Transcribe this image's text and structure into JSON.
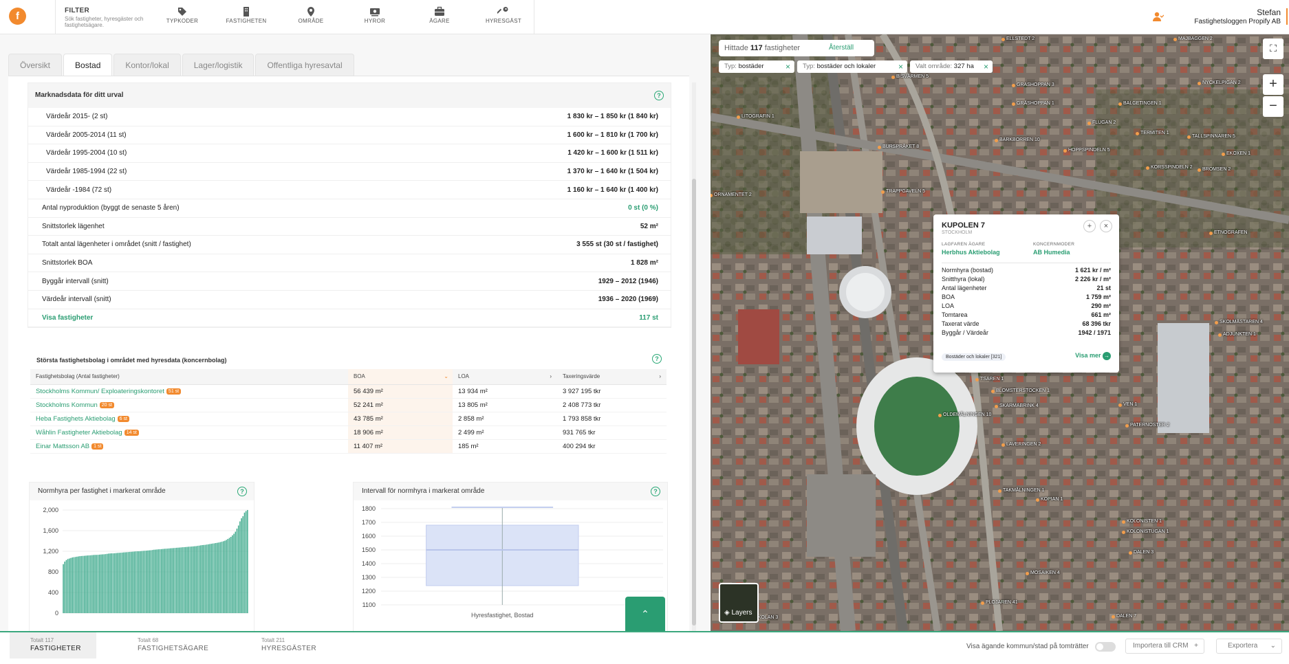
{
  "topbar": {
    "filter_title": "FILTER",
    "filter_desc": "Sök fastigheter, hyresgäster och fastighetsägare.",
    "nav": [
      {
        "label": "TYPKODER",
        "icon": "tag-icon"
      },
      {
        "label": "FASTIGHETEN",
        "icon": "building-icon"
      },
      {
        "label": "OMRÅDE",
        "icon": "map-pin-icon"
      },
      {
        "label": "HYROR",
        "icon": "money-icon"
      },
      {
        "label": "ÄGARE",
        "icon": "briefcase-icon"
      },
      {
        "label": "HYRESGÄST",
        "icon": "key-icon"
      }
    ],
    "user_name": "Stefan",
    "user_org": "Fastighetsloggen Propify AB"
  },
  "tabs": [
    "Översikt",
    "Bostad",
    "Kontor/lokal",
    "Lager/logistik",
    "Offentliga hyresavtal"
  ],
  "active_tab": "Bostad",
  "market": {
    "title": "Marknadsdata för ditt urval",
    "rows": [
      {
        "label": "Värdeår 2015-  (2 st)",
        "value": "1 830 kr – 1 850 kr (1 840 kr)",
        "sub": true
      },
      {
        "label": "Värdeår 2005-2014  (11 st)",
        "value": "1 600 kr – 1 810 kr (1 700 kr)",
        "sub": true
      },
      {
        "label": "Värdeår 1995-2004  (10 st)",
        "value": "1 420 kr – 1 600 kr (1 511 kr)",
        "sub": true
      },
      {
        "label": "Värdeår 1985-1994  (22 st)",
        "value": "1 370 kr – 1 640 kr (1 504 kr)",
        "sub": true
      },
      {
        "label": "Värdeår -1984  (72 st)",
        "value": "1 160 kr – 1 640 kr (1 400 kr)",
        "sub": true
      },
      {
        "label": "Antal nyproduktion (byggt de senaste 5 åren)",
        "value": "0 st (0 %)",
        "green": true
      },
      {
        "label": "Snittstorlek lägenhet",
        "value": "52 m²"
      },
      {
        "label": "Totalt antal lägenheter i området (snitt / fastighet)",
        "value": "3 555 st (30 st / fastighet)"
      },
      {
        "label": "Snittstorlek BOA",
        "value": "1 828 m²"
      },
      {
        "label": "Byggår intervall (snitt)",
        "value": "1929 – 2012 (1946)"
      },
      {
        "label": "Värdeår intervall (snitt)",
        "value": "1936 – 2020 (1969)"
      },
      {
        "label": "Visa fastigheter",
        "value": "117 st",
        "link": true
      }
    ]
  },
  "bolag": {
    "title": "Största fastighetsbolag i området med hyresdata (koncernbolag)",
    "headers": [
      "Fastighetsbolag (Antal fastigheter)",
      "BOA",
      "LOA",
      "Taxeringsvärde"
    ],
    "rows": [
      {
        "name": "Stockholms Kommun/ Exploateringskontoret",
        "count": "51 st",
        "boa": "56 439 m²",
        "loa": "13 934 m²",
        "tax": "3 927 195 tkr"
      },
      {
        "name": "Stockholms Kommun",
        "count": "20 st",
        "boa": "52 241 m²",
        "loa": "13 805 m²",
        "tax": "2 408 773 tkr"
      },
      {
        "name": "Heba Fastighets Aktiebolag",
        "count": "6 st",
        "boa": "43 785 m²",
        "loa": "2 858 m²",
        "tax": "1 793 858 tkr"
      },
      {
        "name": "Wåhlin Fastigheter Aktiebolag",
        "count": "14 st",
        "boa": "18 906 m²",
        "loa": "2 499 m²",
        "tax": "931 765 tkr"
      },
      {
        "name": "Einar Mattsson AB",
        "count": "1 st",
        "boa": "11 407 m²",
        "loa": "185 m²",
        "tax": "400 294 tkr"
      }
    ]
  },
  "chart_data": [
    {
      "type": "bar",
      "title": "Normhyra per fastighet i markerat område",
      "yticks": [
        "2,000",
        "1,600",
        "1,200",
        "800",
        "400",
        "0"
      ],
      "ylim": [
        0,
        2000
      ],
      "values": [
        950,
        1000,
        1030,
        1050,
        1060,
        1070,
        1080,
        1085,
        1090,
        1095,
        1100,
        1105,
        1108,
        1110,
        1112,
        1115,
        1118,
        1120,
        1122,
        1125,
        1128,
        1130,
        1130,
        1132,
        1135,
        1138,
        1140,
        1142,
        1145,
        1150,
        1155,
        1158,
        1160,
        1160,
        1162,
        1165,
        1168,
        1170,
        1172,
        1175,
        1178,
        1180,
        1182,
        1185,
        1188,
        1190,
        1192,
        1195,
        1198,
        1200,
        1200,
        1202,
        1205,
        1208,
        1210,
        1212,
        1215,
        1218,
        1220,
        1225,
        1230,
        1232,
        1235,
        1238,
        1240,
        1242,
        1245,
        1248,
        1250,
        1252,
        1255,
        1258,
        1260,
        1262,
        1265,
        1268,
        1270,
        1272,
        1275,
        1278,
        1280,
        1282,
        1285,
        1288,
        1290,
        1292,
        1295,
        1298,
        1300,
        1305,
        1310,
        1315,
        1320,
        1322,
        1325,
        1330,
        1335,
        1340,
        1345,
        1350,
        1355,
        1360,
        1365,
        1370,
        1378,
        1385,
        1395,
        1405,
        1420,
        1440,
        1460,
        1480,
        1510,
        1540,
        1580,
        1640,
        1700,
        1780,
        1840,
        1880,
        1950,
        1980,
        2000
      ]
    },
    {
      "type": "box",
      "title": "Intervall för normhyra i markerat område",
      "category": "Hyresfastighet, Bostad",
      "yticks": [
        "1800",
        "1700",
        "1600",
        "1500",
        "1400",
        "1300",
        "1200",
        "1100"
      ],
      "ylim": [
        1100,
        1800
      ],
      "min": 1100,
      "q1": 1240,
      "median": 1500,
      "q3": 1680,
      "max": 1810
    }
  ],
  "bottom": {
    "panes": [
      {
        "small": "Totalt 117",
        "label": "FASTIGHETER"
      },
      {
        "small": "Totalt 68",
        "label": "FASTIGHETSÄGARE"
      },
      {
        "small": "Totalt 211",
        "label": "HYRESGÄSTER"
      }
    ],
    "toggle_label": "Visa ägande kommun/stad på tomträtter",
    "crm_label": "Importera till CRM",
    "export_label": "Exportera"
  },
  "map": {
    "found_prefix": "Hittade",
    "found_count": "117",
    "found_suffix": "fastigheter",
    "reset": "Återställ",
    "chips": [
      {
        "key": "Typ:",
        "val": "bostäder"
      },
      {
        "key": "Typ:",
        "val": "bostäder och lokaler"
      },
      {
        "key": "Valt område:",
        "val": "327 ha"
      }
    ],
    "layers_label": "Layers",
    "popup": {
      "title": "KUPOLEN 7",
      "city": "STOCKHOLM",
      "owner_label": "LAGFAREN ÄGARE",
      "owner": "Herbhus Aktiebolag",
      "group_label": "KONCERNMODER",
      "group": "AB Humedia",
      "rows": [
        {
          "label": "Normhyra (bostad)",
          "value": "1 621 kr / m²"
        },
        {
          "label": "Snitthyra (lokal)",
          "value": "2 226 kr / m²"
        },
        {
          "label": "Antal lägenheter",
          "value": "21 st"
        },
        {
          "label": "BOA",
          "value": "1 759 m²"
        },
        {
          "label": "LOA",
          "value": "290 m²"
        },
        {
          "label": "Tomtarea",
          "value": "661 m²"
        },
        {
          "label": "Taxerat värde",
          "value": "68 396 tkr"
        },
        {
          "label": "Byggår / Värdeår",
          "value": "1942 / 1971"
        }
      ],
      "foot": "Bostäder och lokaler [321]",
      "more": "Visa mer"
    },
    "labels": [
      "ELLSTEDT 2",
      "MAJBAGGEN 2",
      "BISVÄRMEN 5",
      "GRASHOPPAN 3",
      "GRÄSHOPPAN 1",
      "BALGETINGEN 1",
      "NYCKELPIGAN 2",
      "LITOGRAFIN 1",
      "BARKBORREN 10",
      "FLUGAN 2",
      "TERMITEN 1",
      "TALLSPINNAREN 5",
      "EKOXEN 1",
      "HOPPSPINDELN 5",
      "BROMSEN 2",
      "KORSSPINDELN 2",
      "BURSPRÅKET 8",
      "TRAPPGAVELN 5",
      "ETNOGRAFEN",
      "SKOLMÄSTAREN 4",
      "ADJUNKTEN 1",
      "TSAREN 1",
      "BLOMSTERSTOCKEN 1",
      "SKARMABRINK 4",
      "OLDEMÅLNINGEN 10",
      "LAVERINGEN 2",
      "TAKMÅLNINGEN 1",
      "KOPIAN 1",
      "KOLONISTEN 1",
      "KOLONISTUGAN 1",
      "DALEN 3",
      "MOSAIKEN 4",
      "PLOJAREN 41",
      "DALEN 7",
      "VEN 1",
      "PATERNOSTER 2",
      "TRADSKOLAN 3",
      "ORNAMENTET 2"
    ]
  },
  "colors": {
    "accent": "#2a9d72",
    "brand": "#f28a2e",
    "bar": "#3aa88a",
    "box": "#dbe3f7"
  }
}
